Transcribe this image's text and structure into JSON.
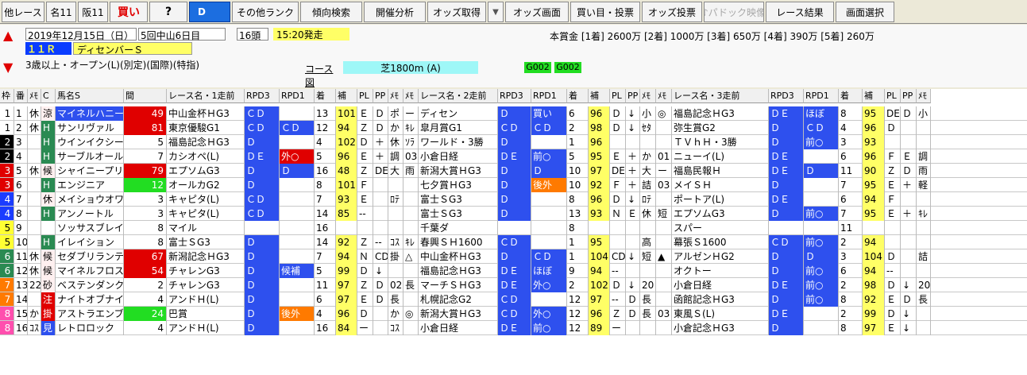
{
  "toolbar": {
    "buttons": [
      {
        "label": "他レース",
        "k": ""
      },
      {
        "label": "名11",
        "k": ""
      },
      {
        "label": "阪11",
        "k": ""
      },
      {
        "label": "買い",
        "k": "kai"
      },
      {
        "label": "?",
        "k": "q"
      },
      {
        "label": "D",
        "k": "d"
      },
      {
        "label": "その他ランク",
        "k": ""
      },
      {
        "label": "傾向検索",
        "k": ""
      },
      {
        "label": "開催分析",
        "k": ""
      },
      {
        "label": "オッズ取得",
        "k": ""
      },
      {
        "label": "▼",
        "k": "arr"
      },
      {
        "label": "オッズ画面",
        "k": ""
      },
      {
        "label": "買い目・投票",
        "k": ""
      },
      {
        "label": "オッズ投票",
        "k": ""
      },
      {
        "label": "♪パドック映像",
        "k": "dis"
      },
      {
        "label": "レース結果",
        "k": ""
      },
      {
        "label": "画面選択",
        "k": ""
      }
    ]
  },
  "race": {
    "up_arrow": "▲",
    "down_arrow": "▼",
    "date": "2019年12月15日（日）",
    "meeting": "5回中山6日目",
    "runners": "16頭",
    "post_time": "15:20発走",
    "race_no": "１１Ｒ",
    "race_name": "ディセンバーＳ",
    "condition": "3歳以上・オープン(L)(別定)(国際)(特指)",
    "course_label": "コース図",
    "course": "芝1800m (A)",
    "code1": "G002",
    "code2": "G002",
    "prize": "本賞金 [1着] 2600万 [2着] 1000万 [3着] 650万 [4着] 390万 [5着] 260万"
  },
  "colors": {
    "rating": "#2e50ee",
    "orange": "#ff7a00",
    "red_cell": "#e00000",
    "highlight": "#ffff66",
    "cyan": "#9ef7f7"
  },
  "table": {
    "headers": [
      "枠",
      "番",
      "ﾒﾓ",
      "C",
      "馬名S",
      "間",
      "レース名・1走前",
      "RPD3",
      "RPD1",
      "着",
      "補",
      "PL",
      "PP",
      "ﾒﾓ",
      "ﾒﾓ",
      "レース名・2走前",
      "RPD3",
      "RPD1",
      "着",
      "補",
      "PL",
      "PP",
      "ﾒﾓ",
      "ﾒﾓ",
      "レース名・3走前",
      "RPD3",
      "RPD1",
      "着",
      "補",
      "PL",
      "PP",
      "ﾒﾓ"
    ],
    "rows": [
      [
        "1",
        "1",
        "休",
        "涼",
        "マイネルハニー",
        "49",
        "中山金杯ＨG3",
        "ＣＤ",
        "",
        "13",
        "101",
        "Ｅ",
        "Ｄ",
        "ポ",
        "ー",
        "ディセン",
        "Ｄ",
        "買い",
        "6",
        "96",
        "Ｄ",
        "↓",
        "小",
        "◎",
        "福島記念ＨG3",
        "ＤＥ",
        "ほぼ",
        "8",
        "95",
        "DE",
        "Ｄ",
        "小"
      ],
      [
        "1",
        "2",
        "休",
        "H",
        "サンリヴァル",
        "81",
        "東京優駿G1",
        "ＣＤ",
        "ＣＤ",
        "12",
        "94",
        "Ｚ",
        "Ｄ",
        "か",
        "ｷﾚ",
        "皐月賞G1",
        "ＣＤ",
        "ＣＤ",
        "2",
        "98",
        "Ｄ",
        "↓",
        "ｾﾀ",
        "",
        "弥生賞G2",
        "Ｄ",
        "ＣＤ",
        "4",
        "96",
        "Ｄ",
        "",
        ""
      ],
      [
        "2",
        "3",
        "",
        "H",
        "ウインイクシード",
        "5",
        "福島記念ＨG3",
        "Ｄ",
        "",
        "4",
        "102",
        "Ｄ",
        "＋",
        "休",
        "ｿﾗ",
        "ワールド・3勝",
        "Ｄ",
        "",
        "1",
        "96",
        "",
        "",
        "",
        "",
        "ＴＶｈＨ・3勝",
        "Ｄ",
        "前○",
        "3",
        "93",
        "",
        "",
        ""
      ],
      [
        "2",
        "4",
        "",
        "H",
        "サーブルオール",
        "7",
        "カシオペ(L)",
        "ＤＥ",
        "外○",
        "5",
        "96",
        "Ｅ",
        "＋",
        "調",
        "03",
        "小倉日経",
        "ＤＥ",
        "前○",
        "5",
        "95",
        "Ｅ",
        "＋",
        "か",
        "01",
        "ニューイ(L)",
        "ＤＥ",
        "",
        "6",
        "96",
        "Ｆ",
        "Ｅ",
        "調"
      ],
      [
        "3",
        "5",
        "休",
        "候",
        "シャイニープリンス",
        "79",
        "エプソムG3",
        "Ｄ",
        "Ｄ",
        "16",
        "48",
        "Ｚ",
        "DE",
        "大",
        "雨",
        "新潟大賞ＨG3",
        "Ｄ",
        "Ｄ",
        "10",
        "97",
        "DE",
        "＋",
        "大",
        "ー",
        "福島民報Ｈ",
        "ＤＥ",
        "Ｄ",
        "11",
        "90",
        "Ｚ",
        "Ｄ",
        "雨"
      ],
      [
        "3",
        "6",
        "",
        "H",
        "エンジニア",
        "12",
        "オールカG2",
        "Ｄ",
        "",
        "8",
        "101",
        "Ｆ",
        "",
        "",
        "",
        "七夕賞ＨG3",
        "Ｄ",
        "後外",
        "10",
        "92",
        "Ｆ",
        "＋",
        "詰",
        "03",
        "メイＳＨ",
        "Ｄ",
        "",
        "7",
        "95",
        "Ｅ",
        "＋",
        "軽"
      ],
      [
        "4",
        "7",
        "",
        "休",
        "メイショウオワラ",
        "3",
        "キャピタ(L)",
        "ＣＤ",
        "",
        "7",
        "93",
        "Ｅ",
        "",
        "ﾛﾃ",
        "",
        "富士ＳG3",
        "Ｄ",
        "",
        "8",
        "96",
        "Ｄ",
        "↓",
        "ﾛﾃ",
        "",
        "ポートア(L)",
        "ＤＥ",
        "",
        "6",
        "94",
        "Ｆ",
        "",
        ""
      ],
      [
        "4",
        "8",
        "",
        "H",
        "アンノートル",
        "3",
        "キャピタ(L)",
        "ＣＤ",
        "",
        "14",
        "85",
        "--",
        "",
        "",
        "",
        "富士ＳG3",
        "Ｄ",
        "",
        "13",
        "93",
        "Ｎ",
        "Ｅ",
        "休",
        "短",
        "エプソムG3",
        "Ｄ",
        "前○",
        "7",
        "95",
        "Ｅ",
        "＋",
        "ｷﾚ"
      ],
      [
        "5",
        "9",
        "",
        "",
        "ソッサスブレイ",
        "8",
        "マイル",
        "",
        "",
        "16",
        "",
        "",
        "",
        "",
        "",
        "千葉ダ",
        "",
        "",
        "8",
        "",
        "",
        "",
        "",
        "",
        "スパー",
        "",
        "",
        "11",
        "",
        "",
        "",
        ""
      ],
      [
        "5",
        "10",
        "",
        "H",
        "イレイション",
        "8",
        "富士ＳG3",
        "Ｄ",
        "",
        "14",
        "92",
        "Ｚ",
        "--",
        "ｺｽ",
        "ｷﾚ",
        "春興ＳＨ1600",
        "ＣＤ",
        "",
        "1",
        "95",
        "",
        "",
        "高",
        "",
        "幕張Ｓ1600",
        "ＣＤ",
        "前○",
        "2",
        "94",
        "",
        "",
        ""
      ],
      [
        "6",
        "11",
        "休",
        "候",
        "セダブリランテス",
        "67",
        "新潟記念ＨG3",
        "Ｄ",
        "",
        "7",
        "94",
        "Ｎ",
        "CD",
        "掛",
        "△",
        "中山金杯ＨG3",
        "Ｄ",
        "ＣＤ",
        "1",
        "104",
        "CD",
        "↓",
        "短",
        "▲",
        "アルゼンＨG2",
        "Ｄ",
        "Ｄ",
        "3",
        "104",
        "Ｄ",
        "",
        "詰"
      ],
      [
        "6",
        "12",
        "休",
        "候",
        "マイネルフロスト",
        "54",
        "チャレンG3",
        "Ｄ",
        "候補",
        "5",
        "99",
        "Ｄ",
        "↓",
        "",
        "",
        "福島記念ＨG3",
        "ＤＥ",
        "ほぼ",
        "9",
        "94",
        "--",
        "",
        "",
        "",
        "オクトー",
        "Ｄ",
        "前○",
        "6",
        "94",
        "--",
        "",
        ""
      ],
      [
        "7",
        "13",
        "22",
        "砂",
        "ベステンダンク",
        "2",
        "チャレンG3",
        "Ｄ",
        "",
        "11",
        "97",
        "Ｚ",
        "Ｄ",
        "02",
        "長",
        "マーチＳＨG3",
        "ＤＥ",
        "外○",
        "2",
        "102",
        "Ｄ",
        "↓",
        "20",
        "",
        "小倉日経",
        "ＤＥ",
        "前○",
        "2",
        "98",
        "Ｄ",
        "↓",
        "20"
      ],
      [
        "7",
        "14",
        "",
        "注",
        "ナイトオブナイツ",
        "4",
        "アンドＨ(L)",
        "Ｄ",
        "",
        "6",
        "97",
        "Ｅ",
        "Ｄ",
        "長",
        "",
        "札幌記念G2",
        "ＣＤ",
        "",
        "12",
        "97",
        "--",
        "Ｄ",
        "長",
        "",
        "函館記念ＨG3",
        "Ｄ",
        "前○",
        "8",
        "92",
        "Ｅ",
        "Ｄ",
        "長"
      ],
      [
        "8",
        "15",
        "か",
        "掛",
        "アストラエンブレム",
        "24",
        "巴賞",
        "Ｄ",
        "後外",
        "4",
        "96",
        "Ｄ",
        "",
        "か",
        "◎",
        "新潟大賞ＨG3",
        "ＣＤ",
        "外○",
        "12",
        "96",
        "Ｚ",
        "Ｄ",
        "長",
        "03",
        "東風Ｓ(L)",
        "ＤＥ",
        "",
        "2",
        "99",
        "Ｄ",
        "↓",
        ""
      ],
      [
        "8",
        "16",
        "ｺｽ",
        "見",
        "レトロロック",
        "4",
        "アンドＨ(L)",
        "Ｄ",
        "",
        "16",
        "84",
        "ー",
        "",
        "ｺｽ",
        "",
        "小倉日経",
        "ＤＥ",
        "前○",
        "12",
        "89",
        "ー",
        "",
        "",
        "",
        "小倉記念ＨG3",
        "Ｄ",
        "",
        "8",
        "97",
        "Ｅ",
        "↓",
        ""
      ]
    ]
  }
}
